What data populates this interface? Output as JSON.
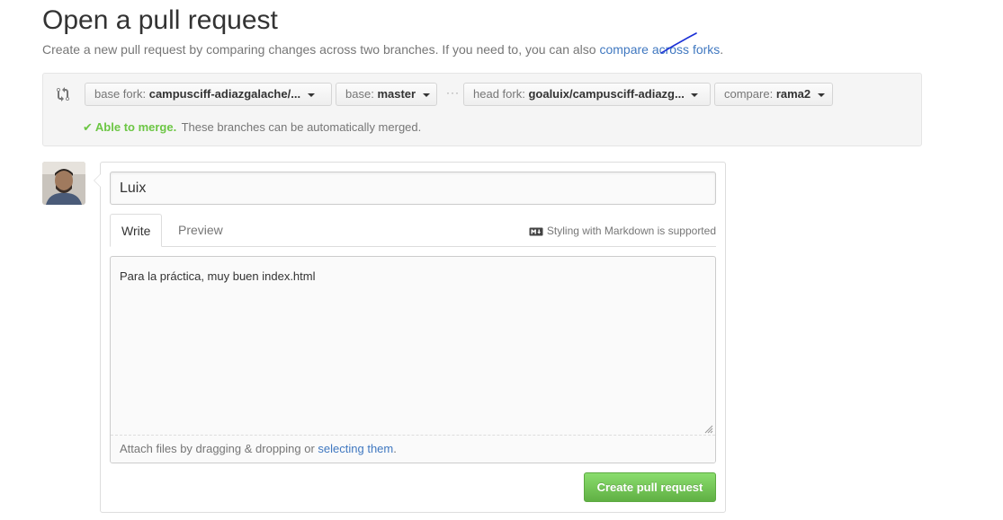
{
  "page": {
    "title": "Open a pull request",
    "subtitle": "Create a new pull request by comparing changes across two branches. If you need to, you can also ",
    "subtitle_link": "compare across forks",
    "subtitle_end": "."
  },
  "range": {
    "base_fork": {
      "label": "base fork:",
      "value": "campusciff-adiazgalache/..."
    },
    "base": {
      "label": "base:",
      "value": "master"
    },
    "separator": "···",
    "head_fork": {
      "label": "head fork:",
      "value": "goaluix/campusciff-adiazg..."
    },
    "compare": {
      "label": "compare:",
      "value": "rama2"
    },
    "merge_status": {
      "title": "Able to merge.",
      "detail": "These branches can be automatically merged."
    }
  },
  "form": {
    "title_value": "Luix",
    "tabs": [
      {
        "label": "Write"
      },
      {
        "label": "Preview"
      }
    ],
    "markdown_note": "Styling with Markdown is supported",
    "body": "Para la práctica, muy buen index.html",
    "attach_text": "Attach files by dragging & dropping or ",
    "attach_link": "selecting them",
    "attach_end": ".",
    "submit_label": "Create pull request"
  },
  "colors": {
    "link": "#4078c0",
    "success": "#6cc644",
    "primary_button": "#60b044"
  },
  "icons": [
    "git-compare-icon",
    "check-icon",
    "markdown-icon",
    "caret-down-icon",
    "resize-grip-icon",
    "avatar"
  ]
}
